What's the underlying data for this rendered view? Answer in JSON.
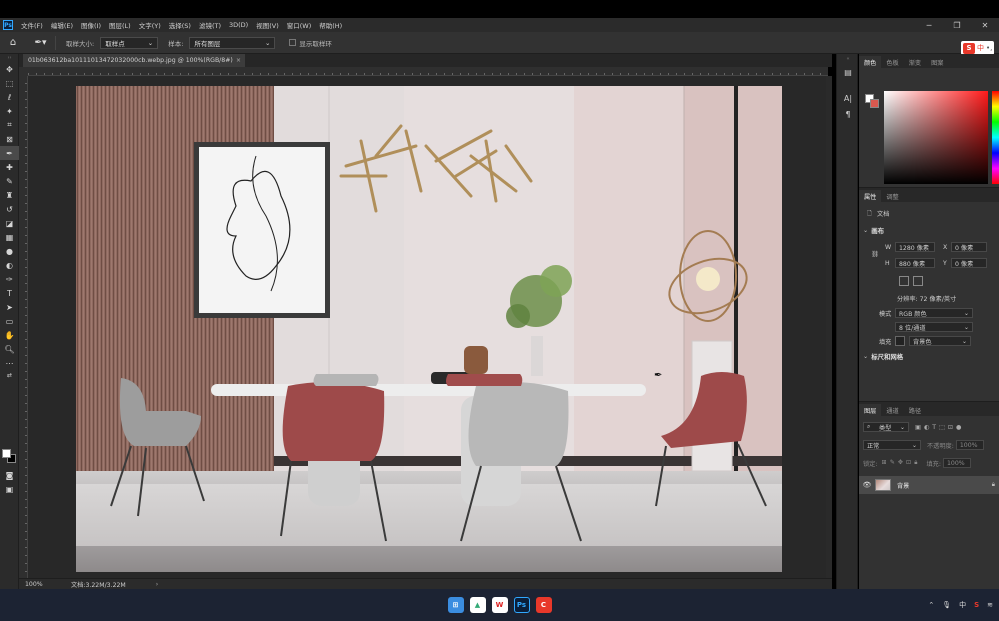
{
  "menubar": {
    "app_icon": "Ps",
    "items": [
      "文件(F)",
      "编辑(E)",
      "图像(I)",
      "图层(L)",
      "文字(Y)",
      "选择(S)",
      "滤镜(T)",
      "3D(D)",
      "视图(V)",
      "窗口(W)",
      "帮助(H)"
    ]
  },
  "options": {
    "sample_size_label": "取样大小:",
    "sample_size_value": "取样点",
    "sample_label": "样本:",
    "sample_value": "所有图层",
    "show_ring_label": "显示取样环"
  },
  "ime": {
    "logo": "S",
    "mode": "中"
  },
  "document": {
    "tab_title": "01b063612ba10111013472032000cb.webp.jpg @ 100%(RGB/8#)",
    "zoom": "100%",
    "doc_info": "文档:3.22M/3.22M"
  },
  "panels": {
    "top_tabs": [
      "颜色",
      "色板",
      "渐变",
      "图案"
    ],
    "props_tabs": [
      "属性",
      "调整"
    ],
    "doc_label": "文档",
    "canvas_section": "画布",
    "width_label": "W",
    "width_value": "1280 像素",
    "height_label": "H",
    "height_value": "880 像素",
    "x_label": "X",
    "x_value": "0 像素",
    "y_label": "Y",
    "y_value": "0 像素",
    "resolution": "分辨率: 72 像素/英寸",
    "mode_label": "模式",
    "mode_value": "RGB 颜色",
    "depth_value": "8 位/通道",
    "fill_label": "填充",
    "fill_value": "背景色",
    "rulers_section": "标尺和网格",
    "layers_tabs": [
      "图层",
      "通道",
      "路径"
    ],
    "kind_label": "类型",
    "blend_mode": "正常",
    "opacity_label": "不透明度:",
    "opacity_value": "100%",
    "lock_label": "锁定:",
    "fill_pct_label": "填充:",
    "fill_pct_value": "100%",
    "layer_name": "背景"
  },
  "tray": {
    "ime_label": "中"
  }
}
